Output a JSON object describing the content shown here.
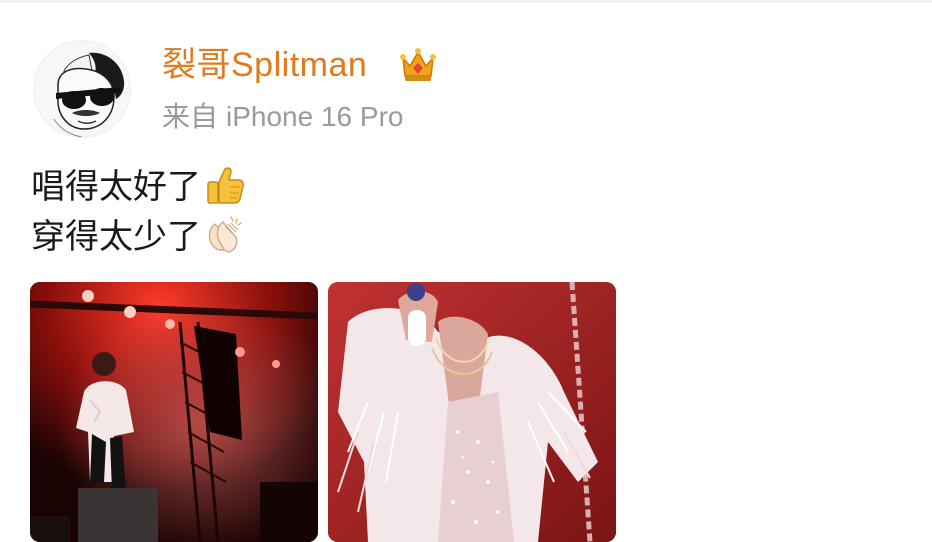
{
  "post": {
    "author": {
      "name": "裂哥Splitman",
      "avatar_icon": "cartoon-man-with-sunglasses-avatar",
      "badge_icon": "crown-icon",
      "name_color": "#e07a1c"
    },
    "source": {
      "prefix": "来自",
      "device": "iPhone 16 Pro"
    },
    "content": {
      "lines": [
        {
          "text": "唱得太好了",
          "emoji": "thumbs-up-icon"
        },
        {
          "text": "穿得太少了",
          "emoji": "clapping-hands-icon"
        }
      ]
    },
    "images": [
      {
        "icon": "concert-stage-photo"
      },
      {
        "icon": "singer-closeup-photo"
      }
    ]
  }
}
